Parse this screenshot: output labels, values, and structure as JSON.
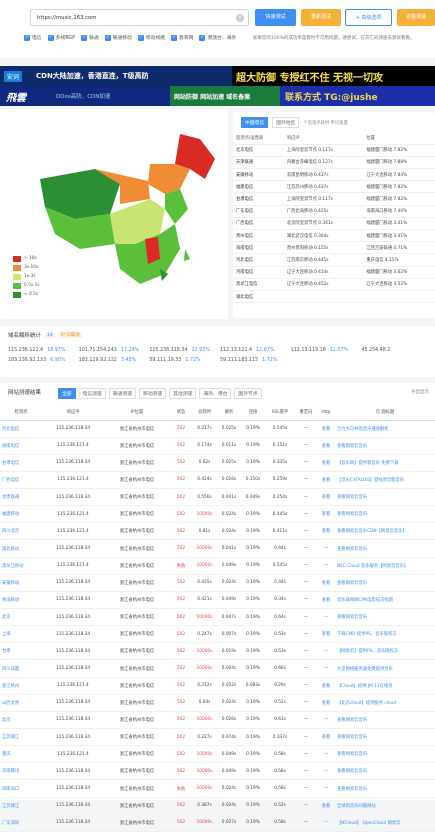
{
  "search": {
    "url": "https://music.163.com",
    "buttons": [
      "快速测试",
      "重新测试",
      "+ 高级选项",
      "完整测速"
    ],
    "options": [
      "电信",
      "多线BGP",
      "联通",
      "联通移动",
      "移动线路",
      "教育网",
      "港澳台、海外"
    ],
    "note": "如果您的100%的成功率是暂时不可用问题，请尝试，在其它的测速去测试看看。"
  },
  "banners": [
    {
      "text": "安词",
      "sub": "CDN大陆加速，香港直连，T级高防",
      "right": "超大防御 专授红不住 无视一切攻"
    },
    {
      "text": "飛雲",
      "sub": "DDos高防、CDN加速",
      "mid": "网站防御 网站加速 域名备案",
      "right": "联系方式 TG:@jushe"
    }
  ],
  "map": {
    "legend": [
      "> 10s",
      "3s-10s",
      "1s-3s",
      "0.5s-1s",
      "< 0.5s"
    ],
    "legend_colors": [
      "#d92b23",
      "#f08c36",
      "#c8e573",
      "#5cbf3b",
      "#2d8f34"
    ]
  },
  "isp": {
    "tabs": [
      "中国电信",
      "国外地区"
    ],
    "hint": "个监测点耗时 平均速度",
    "headers": [
      "监测点/运营商",
      "响应IP",
      "解析IP",
      "位置"
    ],
    "rows": [
      [
        "北京电信",
        "上海阿里云节点 0.117s",
        "福建厦门移动 7.82%"
      ],
      [
        "天津联通",
        "内蒙古赤峰电信 0.127s",
        "福建厦门移动 7.88%"
      ],
      [
        "安徽移动",
        "云南昆明移动 0.437s",
        "辽宁大连移动 7.84%"
      ],
      [
        "福建电信",
        "江苏苏州移动 0.437s",
        "福建厦门移动 7.82%"
      ],
      [
        "甘肃电信",
        "上海阿里云节点 0.117s",
        "福建厦门移动 7.82%"
      ],
      [
        "广东电信",
        "广西北海移动 0.425s",
        "海南海口移动 7.40%"
      ],
      [
        "广西电信",
        "北京阿里云节点 0.341s",
        "福建厦门移动 3.41%"
      ],
      [
        "贵州电信",
        "湖北武汉电信 0.364s",
        "福建厦门移动 3.41%"
      ],
      [
        "海南电信",
        "贵州贵阳移动 0.155s",
        "江西吉安联通 0.71%"
      ],
      [
        "河北电信",
        "江苏南京移动 0.445s",
        "重庆电信 4.15%"
      ],
      [
        "河南电信",
        "辽宁大连移动 0.414s",
        "福建厦门移动 3.62%"
      ],
      [
        "黑龙江电信",
        "辽宁大连移动 0.452s",
        "辽宁大连移动 3.52%"
      ],
      [
        "湖北电信",
        "",
        "",
        ""
      ]
    ]
  },
  "stats": {
    "title": "域名解析统计",
    "badge": "14",
    "sub": "IP 归属地",
    "cells": [
      [
        "115.236.121.4",
        "18.97%"
      ],
      [
        "101.71.154.243",
        "17.24%"
      ],
      [
        "115.236.118.34",
        "12.93%"
      ],
      [
        "112.13.122.4",
        "12.07%"
      ],
      [
        "112.13.119.18",
        "12.07%"
      ],
      [
        "45.254.48.2",
        ""
      ],
      [
        "183.136.92.133",
        "6.90%"
      ],
      [
        "183.129.92.132",
        "3.45%"
      ],
      [
        "59.111.19.33",
        "1.72%"
      ],
      [
        "59.111.183.115",
        "1.72%"
      ]
    ]
  },
  "main": {
    "title": "网站测速结果",
    "tabs": [
      "全部",
      "电信测速",
      "联通测速",
      "移动测速",
      "其他测速",
      "海外、港台",
      "国外节点"
    ],
    "export": "导出显示",
    "headers": [
      "检测点",
      "响应IP",
      "IP位置",
      "状态",
      "总耗时",
      "解析",
      "连接",
      "SSL握手",
      "重定向",
      "Http",
      "页 面标题"
    ],
    "rows": [
      [
        "河北电信",
        "115.236.118.34",
        "浙江省杭州市电信",
        "502",
        "0.217s",
        "0.025s",
        "0.19%",
        "0.545s",
        "—",
        "查看",
        "全力大白并的音乐播放解析"
      ],
      [
        "湖南电信",
        "115.236.121.4",
        "浙江省杭州市电信",
        "502",
        "0.174s",
        "0.011s",
        "0.19%",
        "0.151s",
        "—",
        "查看",
        "查看网易云音乐"
      ],
      [
        "甘肃电信",
        "115.236.118.34",
        "浙江省杭州市电信",
        "502",
        "0.62s",
        "0.025s",
        "0.19%",
        "0.335s",
        "—",
        "查看",
        "【音乐网】提供新音乐 免费下载"
      ],
      [
        "广西电信",
        "115.236.121.4",
        "浙江省杭州市电信",
        "502",
        "0.424s",
        "0.016s",
        "0.150s",
        "0.259s",
        "—",
        "查看",
        "【音乐CATALOG】登陆到全能音乐"
      ],
      [
        "甘肃联通",
        "115.236.118.34",
        "浙江省杭州市电信",
        "502",
        "0.556s",
        "0.041s",
        "0.049s",
        "0.254s",
        "—",
        "查看",
        "查看网易云音乐"
      ],
      [
        "福建移动",
        "115.236.121.4",
        "浙江省杭州市电信",
        "502",
        "10000s",
        "0.024s",
        "0.19%",
        "0.445s",
        "—",
        "查看",
        "查看网易云音乐"
      ],
      [
        "四川北京",
        "115.236.121.4",
        "浙江省杭州市电信",
        "502",
        "0.81s",
        "0.024s",
        "0.19%",
        "0.411s",
        "—",
        "查看",
        "查看网易云音乐CDN【网易云音乐】"
      ],
      [
        "湖北移动",
        "115.236.118.34",
        "浙江省杭州市电信",
        "502",
        "10000s",
        "0.041s",
        "0.19%",
        "0.44s",
        "—",
        "—",
        "查看网易云音乐"
      ],
      [
        "黑龙江移动",
        "115.236.121.4",
        "浙江省杭州市电信",
        "失败",
        "10000s",
        "0.049s",
        "0.19%",
        "0.545s",
        "—",
        "—",
        "NEC Cloud 音乐服务【网易云音乐】"
      ],
      [
        "安徽移动",
        "115.236.118.34",
        "浙江省杭州市电信",
        "502",
        "0.435s",
        "0.024s",
        "0.19%",
        "0.44s",
        "—",
        "查看",
        "查看网易云音乐"
      ],
      [
        "青海移动",
        "115.236.118.34",
        "浙江省杭州市电信",
        "502",
        "0.421s",
        "0.049s",
        "0.19%",
        "0.34s",
        "—",
        "查看",
        "音乐联网网CPN电影技巧指南"
      ],
      [
        "北京",
        "115.236.118.34",
        "浙江省杭州市电信",
        "502",
        "10000s",
        "0.047s",
        "0.19%",
        "0.64s",
        "—",
        "—",
        "查看网易云音乐"
      ],
      [
        "上海",
        "115.236.118.34",
        "浙江省杭州市电信",
        "502",
        "0.247s",
        "0.007s",
        "0.19%",
        "0.53s",
        "—",
        "查看",
        "下载CMD 提供PS、音乐版权方"
      ],
      [
        "甘肃",
        "115.236.118.34",
        "浙江省杭州市电信",
        "502",
        "10000s",
        "0.019s",
        "0.19%",
        "0.53s",
        "—",
        "—",
        "【网易云】提供PS、音乐版权方"
      ],
      [
        "四川成都",
        "115.236.118.34",
        "浙江省杭州市电信",
        "502",
        "10000s",
        "0.004s",
        "0.19%",
        "0.66s",
        "—",
        "—",
        "大型网络服务器免费提供音乐"
      ],
      [
        "浙江杭州",
        "115.236.121.4",
        "浙江省杭州市电信",
        "502",
        "0.212s",
        "0.052s",
        "0.083s",
        "0.29s",
        "—",
        "查看",
        "【Cloud】提供 JM 11在线页"
      ],
      [
        "山西太原",
        "115.236.118.34",
        "浙江省杭州市电信",
        "502",
        "0.64s",
        "0.024s",
        "0.19%",
        "0.52s",
        "—",
        "查看",
        "【北京cloud】提供服务 cloud"
      ],
      [
        "北京",
        "115.236.118.34",
        "浙江省杭州市电信",
        "502",
        "10000s",
        "0.026s",
        "0.19%",
        "0.61s",
        "—",
        "—",
        "查看网易云音乐"
      ],
      [
        "江苏镇江",
        "115.236.118.34",
        "浙江省杭州市电信",
        "502",
        "0.227s",
        "0.074s",
        "0.19%",
        "0.337s",
        "—",
        "查看",
        "查看网易云音乐"
      ],
      [
        "重庆",
        "115.236.121.4",
        "浙江省杭州市电信",
        "502",
        "10000s",
        "0.049s",
        "0.19%",
        "0.58s",
        "—",
        "—",
        "查看网易云音乐"
      ],
      [
        "华南腾讯",
        "115.236.118.34",
        "浙江省杭州市电信",
        "502",
        "10000s",
        "0.049s",
        "0.19%",
        "0.58s",
        "—",
        "—",
        "查看网易云音乐"
      ],
      [
        "海南海口",
        "115.236.118.34",
        "浙江省杭州市电信",
        "失败",
        "10000s",
        "0.024s",
        "0.19%",
        "0.58s",
        "—",
        "—",
        "查看网易云音乐"
      ],
      [
        "江苏镇江",
        "115.236.118.34",
        "浙江省杭州市电信",
        "502",
        "0.387s",
        "0.024s",
        "0.19%",
        "0.52s",
        "—",
        "查看",
        "全球到音乐同服网站"
      ],
      [
        "广东深圳",
        "115.236.118.34",
        "浙江省杭州市电信",
        "502",
        "10000s",
        "0.027s",
        "0.19%",
        "0.58s",
        "—",
        "—",
        "【NCloud】 OpenCloud 网易云"
      ]
    ]
  }
}
